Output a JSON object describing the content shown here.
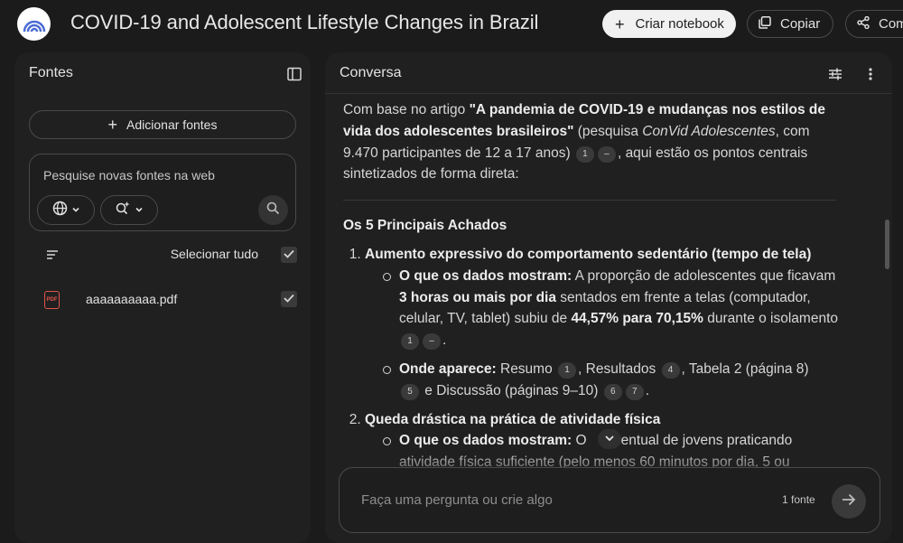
{
  "app": {
    "title": "COVID-19 and Adolescent Lifestyle Changes in Brazil",
    "create_notebook_label": "Criar notebook",
    "copy_label": "Copiar",
    "share_label": "Com"
  },
  "sources_panel": {
    "title": "Fontes",
    "add_sources_label": "Adicionar fontes",
    "search_placeholder": "Pesquise novas fontes na web",
    "select_all_label": "Selecionar tudo",
    "sources": [
      {
        "name": "aaaaaaaaaa.pdf",
        "checked": true
      }
    ]
  },
  "conversation": {
    "title": "Conversa",
    "intro": {
      "prefix": "Com base no artigo ",
      "article_title": "\"A pandemia de COVID-19 e mudanças nos estilos de vida dos adolescentes brasileiros\"",
      "mid1": " (pesquisa ",
      "survey": "ConVid Adolescentes",
      "mid2": ", com 9.470 participantes de 12 a 17 anos)",
      "suffix": ", aqui estão os pontos centrais sintetizados de forma direta:"
    },
    "section_title": "Os 5 Principais Achados",
    "findings": [
      {
        "title": "Aumento expressivo do comportamento sedentário (tempo de tela)",
        "data_label": "O que os dados mostram:",
        "data_text_1": " A proporção de adolescentes que ficavam ",
        "data_bold_1": "3 horas ou mais por dia",
        "data_text_2": " sentados em frente a telas (computador, celular, TV, tablet) subiu de ",
        "data_bold_2": "44,57% para 70,15%",
        "data_text_3": " durante o isolamento",
        "where_label": "Onde aparece:",
        "where_1": " Resumo",
        "where_2": ", Resultados",
        "where_3": ", Tabela 2 (página 8)",
        "where_4": " e Discussão (páginas 9–10)"
      },
      {
        "title": "Queda drástica na prática de atividade física",
        "data_label": "O que os dados mostram:",
        "data_text_a": " O",
        "data_text_b": "centual de jovens praticando atividade física suficiente (pelo menos 60 minutos por dia, 5 ou"
      }
    ],
    "citations": [
      "1",
      "–",
      "1",
      "–",
      "1",
      "4",
      "5",
      "6",
      "7"
    ],
    "input_placeholder": "Faça uma pergunta ou crie algo",
    "source_count": "1 fonte"
  },
  "icons": {
    "logo": "notebooklm-logo-icon",
    "plus": "plus-icon",
    "copy": "copy-icon",
    "share": "share-icon",
    "panel_toggle": "collapse-panel-icon",
    "globe": "globe-icon",
    "research": "research-sparkle-icon",
    "arrow": "arrow-right-icon",
    "sliders": "sliders-icon",
    "more": "more-vert-icon",
    "sort": "filter-lines-icon",
    "check": "check-icon",
    "pdf": "pdf-icon",
    "chevron": "chevron-down-icon"
  },
  "colors": {
    "background": "#1b1b1b",
    "panel": "#202020",
    "accent_pdf": "#e0554a"
  }
}
